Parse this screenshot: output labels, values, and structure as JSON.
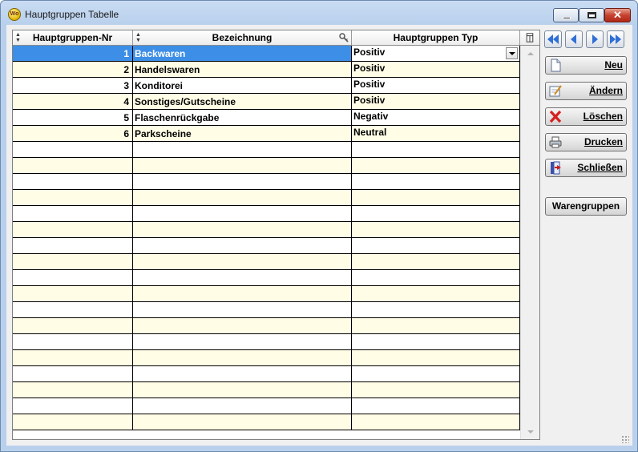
{
  "window": {
    "title": "Hauptgruppen Tabelle",
    "app_icon_text": "Wo"
  },
  "table": {
    "columns": [
      {
        "label": "Hauptgruppen-Nr"
      },
      {
        "label": "Bezeichnung"
      },
      {
        "label": "Hauptgruppen Typ"
      }
    ],
    "rows": [
      {
        "nr": "1",
        "bezeichnung": "Backwaren",
        "typ": "Positiv"
      },
      {
        "nr": "2",
        "bezeichnung": "Handelswaren",
        "typ": "Positiv"
      },
      {
        "nr": "3",
        "bezeichnung": "Konditorei",
        "typ": "Positiv"
      },
      {
        "nr": "4",
        "bezeichnung": "Sonstiges/Gutscheine",
        "typ": "Positiv"
      },
      {
        "nr": "5",
        "bezeichnung": "Flaschenrückgabe",
        "typ": "Negativ"
      },
      {
        "nr": "6",
        "bezeichnung": "Parkscheine",
        "typ": "Neutral"
      }
    ],
    "selected_row": 0
  },
  "buttons": {
    "neu": "Neu",
    "aendern": "Ändern",
    "loeschen": "Löschen",
    "drucken": "Drucken",
    "schliessen": "Schließen",
    "warengruppen": "Warengruppen"
  },
  "colors": {
    "selection": "#3d8ee6",
    "row_alt": "#fffde6",
    "nav_arrow": "#2f6fd6"
  }
}
